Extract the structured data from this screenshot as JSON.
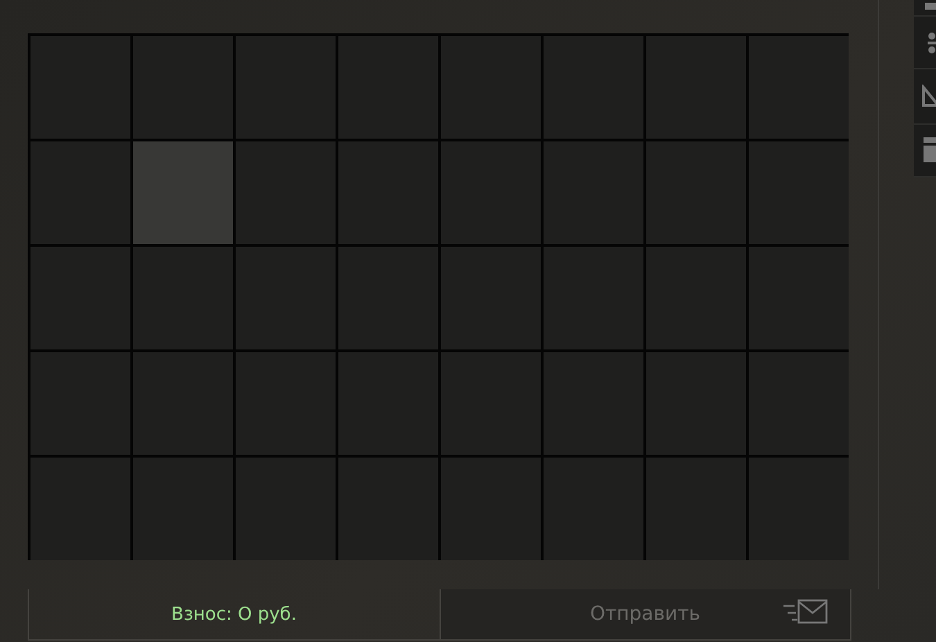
{
  "grid": {
    "rows": [
      {
        "cells": [
          {
            "selected": false
          },
          {
            "selected": false
          },
          {
            "selected": false
          },
          {
            "selected": false
          },
          {
            "selected": false
          },
          {
            "selected": false
          },
          {
            "selected": false
          },
          {
            "selected": false
          }
        ]
      },
      {
        "cells": [
          {
            "selected": false
          },
          {
            "selected": true
          },
          {
            "selected": false
          },
          {
            "selected": false
          },
          {
            "selected": false
          },
          {
            "selected": false
          },
          {
            "selected": false
          },
          {
            "selected": false
          }
        ]
      },
      {
        "cells": [
          {
            "selected": false
          },
          {
            "selected": false
          },
          {
            "selected": false
          },
          {
            "selected": false
          },
          {
            "selected": false
          },
          {
            "selected": false
          },
          {
            "selected": false
          },
          {
            "selected": false
          }
        ]
      },
      {
        "cells": [
          {
            "selected": false
          },
          {
            "selected": false
          },
          {
            "selected": false
          },
          {
            "selected": false
          },
          {
            "selected": false
          },
          {
            "selected": false
          },
          {
            "selected": false
          },
          {
            "selected": false
          }
        ]
      },
      {
        "cells": [
          {
            "selected": false
          },
          {
            "selected": false
          },
          {
            "selected": false
          },
          {
            "selected": false
          },
          {
            "selected": false
          },
          {
            "selected": false
          },
          {
            "selected": false
          },
          {
            "selected": false
          }
        ]
      }
    ]
  },
  "footer": {
    "fee": "Взнос: О руб.",
    "send_button": {
      "label": "Отправить",
      "disabled": true
    }
  }
}
